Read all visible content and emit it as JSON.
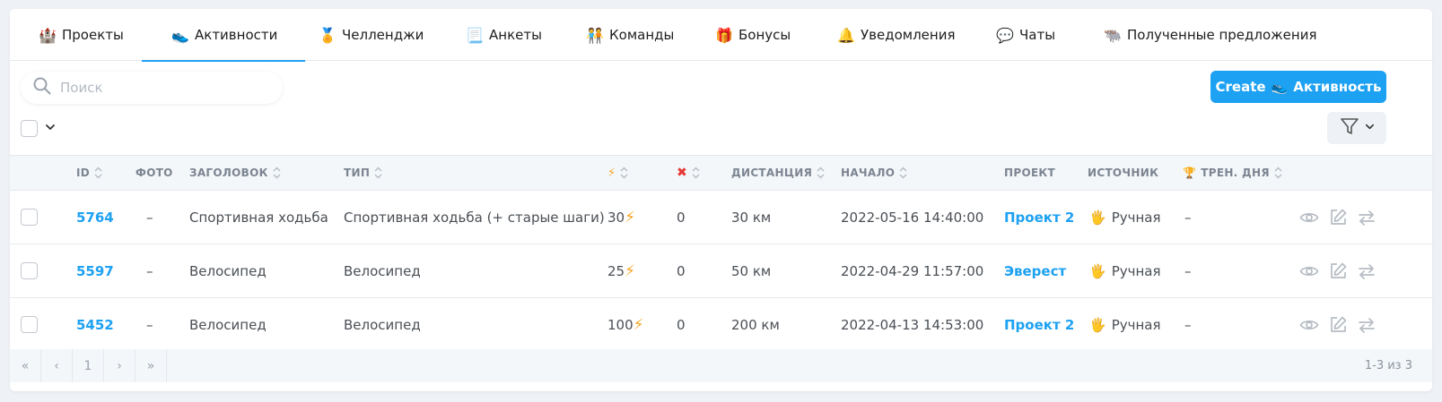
{
  "tabs": [
    {
      "icon": "🏰",
      "label": "Проекты"
    },
    {
      "icon": "👟",
      "label": "Активности"
    },
    {
      "icon": "🏅",
      "label": "Челленджи"
    },
    {
      "icon": "📃",
      "label": "Анкеты"
    },
    {
      "icon": "🧑‍🤝‍🧑",
      "label": "Команды"
    },
    {
      "icon": "🎁",
      "label": "Бонусы"
    },
    {
      "icon": "🔔",
      "label": "Уведомления"
    },
    {
      "icon": "💬",
      "label": "Чаты"
    },
    {
      "icon": "🐃",
      "label": "Полученные предложения"
    }
  ],
  "active_tab": "Активности",
  "search": {
    "placeholder": "Поиск",
    "value": ""
  },
  "create_button": {
    "prefix": "Create",
    "icon": "👟",
    "label": "Активность"
  },
  "columns": {
    "id": "ID",
    "photo": "ФОТО",
    "title": "ЗАГОЛОВОК",
    "type": "ТИП",
    "energy_icon": "⚡",
    "cancel_icon": "✖",
    "distance": "ДИСТАНЦИЯ",
    "start": "НАЧАЛО",
    "project": "ПРОЕКТ",
    "source": "ИСТОЧНИК",
    "trainer_icon": "🏆",
    "trainer": "ТРЕН. ДНЯ"
  },
  "rows": [
    {
      "id": "5764",
      "photo": "–",
      "title": "Спортивная ходьба",
      "type": "Спортивная ходьба (+ старые шаги)",
      "energy": "30",
      "cancel": "0",
      "distance": "30 км",
      "start": "2022-05-16 14:40:00",
      "project": "Проект 2",
      "source_icon": "🖐",
      "source": "Ручная",
      "trainer": "–"
    },
    {
      "id": "5597",
      "photo": "–",
      "title": "Велосипед",
      "type": "Велосипед",
      "energy": "25",
      "cancel": "0",
      "distance": "50 км",
      "start": "2022-04-29 11:57:00",
      "project": "Эверест",
      "source_icon": "🖐",
      "source": "Ручная",
      "trainer": "–"
    },
    {
      "id": "5452",
      "photo": "–",
      "title": "Велосипед",
      "type": "Велосипед",
      "energy": "100",
      "cancel": "0",
      "distance": "200 км",
      "start": "2022-04-13 14:53:00",
      "project": "Проект 2",
      "source_icon": "🖐",
      "source": "Ручная",
      "trainer": "–"
    }
  ],
  "pagination": {
    "first": "«",
    "prev": "‹",
    "current": "1",
    "next": "›",
    "last": "»",
    "summary": "1-3 из 3"
  },
  "colors": {
    "accent": "#1da1f2",
    "energy": "#f5a623",
    "cancel": "#e53935"
  }
}
